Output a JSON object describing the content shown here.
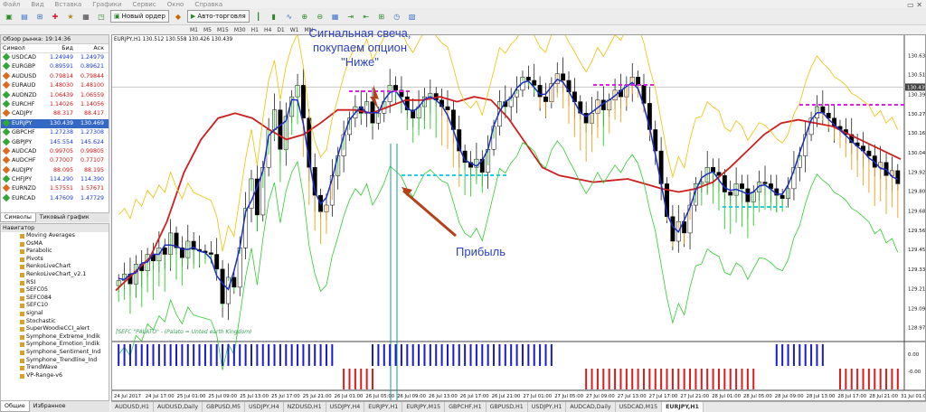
{
  "menu": [
    "Файл",
    "Вид",
    "Вставка",
    "Графики",
    "Сервис",
    "Окно",
    "Справка"
  ],
  "toolbar": {
    "new_order": "Новый ордер",
    "auto_trading": "Авто-торговля",
    "timeframes": [
      "M1",
      "M5",
      "M15",
      "M30",
      "H1",
      "H4",
      "D1",
      "W1",
      "MN"
    ]
  },
  "market_watch": {
    "title": "Обзор рынка: 19:14:36",
    "headers": [
      "Символ",
      "Бид",
      "Аск"
    ],
    "rows": [
      {
        "sym": "USDCAD",
        "bid": "1.24949",
        "ask": "1.24979",
        "color": "#2fa836",
        "dir": "up"
      },
      {
        "sym": "EURGBP",
        "bid": "0.89591",
        "ask": "0.89621",
        "color": "#2fa836",
        "dir": "up"
      },
      {
        "sym": "AUDUSD",
        "bid": "0.79814",
        "ask": "0.79844",
        "color": "#e06a1c",
        "dir": "dn"
      },
      {
        "sym": "EURAUD",
        "bid": "1.48030",
        "ask": "1.48100",
        "color": "#e06a1c",
        "dir": "dn"
      },
      {
        "sym": "AUDNZD",
        "bid": "1.06439",
        "ask": "1.06559",
        "color": "#2fa836",
        "dir": "dn"
      },
      {
        "sym": "EURCHF",
        "bid": "1.14026",
        "ask": "1.14056",
        "color": "#2fa836",
        "dir": "dn"
      },
      {
        "sym": "CADJPY",
        "bid": "88.317",
        "ask": "88.417",
        "color": "#e06a1c",
        "dir": "dn"
      },
      {
        "sym": "EURJPY",
        "bid": "130.439",
        "ask": "130.469",
        "color": "#2fa836",
        "dir": "up",
        "selected": true
      },
      {
        "sym": "GBPCHF",
        "bid": "1.27238",
        "ask": "1.27308",
        "color": "#2fa836",
        "dir": "up"
      },
      {
        "sym": "GBPJPY",
        "bid": "145.554",
        "ask": "145.624",
        "color": "#2fa836",
        "dir": "up"
      },
      {
        "sym": "AUDCAD",
        "bid": "0.99705",
        "ask": "0.99805",
        "color": "#e06a1c",
        "dir": "dn"
      },
      {
        "sym": "AUDCHF",
        "bid": "0.77007",
        "ask": "0.77107",
        "color": "#e06a1c",
        "dir": "dn"
      },
      {
        "sym": "AUDJPY",
        "bid": "88.095",
        "ask": "88.195",
        "color": "#e06a1c",
        "dir": "dn"
      },
      {
        "sym": "CHFJPY",
        "bid": "114.290",
        "ask": "114.390",
        "color": "#2fa836",
        "dir": "up"
      },
      {
        "sym": "EURNZD",
        "bid": "1.57551",
        "ask": "1.57671",
        "color": "#e06a1c",
        "dir": "dn"
      },
      {
        "sym": "EURCAD",
        "bid": "1.47609",
        "ask": "1.47729",
        "color": "#2fa836",
        "dir": "up"
      }
    ],
    "tabs": [
      "Символы",
      "Тиковый график"
    ]
  },
  "navigator": {
    "title": "Навигатор",
    "items": [
      "Moving Averages",
      "OsMA",
      "Parabolic",
      "Pivots",
      "RenkoLiveChart",
      "RenkoLiveChart_v2.1",
      "RSI",
      "SEFC05",
      "SEFC084",
      "SEFC10",
      "signal",
      "Stochastic",
      "SuperWoodieCCI_alert",
      "Symphone_Extreme_Indik",
      "Symphone_Emotion_Indik",
      "Symphone_Sentiment_Ind",
      "Symphone_Trendline_Ind",
      "TrendWave",
      "VP-Range-v6"
    ],
    "tabs": [
      "Общие",
      "Избранное"
    ]
  },
  "chart": {
    "header": "EURJPY,H1  130.512 130.558 130.426 130.439",
    "source_text": "[SEFC \"PALATO\" - (Palato = Unted earth Kingdom)",
    "price_labels": [
      "130.630",
      "130.515",
      "130.395",
      "130.275",
      "130.160",
      "130.040",
      "129.920",
      "129.805",
      "129.685",
      "129.565",
      "129.450",
      "129.330",
      "129.210",
      "129.090",
      "128.975"
    ],
    "current_price": "130.439",
    "osc_labels": [
      "0.00",
      "-0.00"
    ],
    "time_labels": [
      "24 Jul 2017",
      "24 Jul 17:00",
      "25 Jul 01:00",
      "25 Jul 09:00",
      "25 Jul 13:00",
      "25 Jul 17:00",
      "25 Jul 21:00",
      "26 Jul 01:00",
      "26 Jul 05:00",
      "26 Jul 09:00",
      "26 Jul 13:00",
      "26 Jul 17:00",
      "26 Jul 21:00",
      "27 Jul 01:00",
      "27 Jul 05:00",
      "27 Jul 09:00",
      "27 Jul 13:00",
      "27 Jul 17:00",
      "27 Jul 21:00",
      "28 Jul 01:00",
      "28 Jul 05:00",
      "28 Jul 09:00",
      "28 Jul 13:00",
      "28 Jul 17:00",
      "28 Jul 21:00",
      "31 Jul 01:00"
    ],
    "annotation_signal": [
      "Сигнальная свеча,",
      "покупаем опцион",
      "\"Ниже\""
    ],
    "annotation_profit": "Прибыль",
    "tabs": [
      "AUDUSD,H1",
      "AUDUSD,Daily",
      "GBPUSD,M5",
      "USDJPY,H4",
      "NZDUSD,H1",
      "USDJPY,H4",
      "EURJPY,H1",
      "EURJPY,M15",
      "GBPCHF,H1",
      "GBPUSD,H1",
      "USDJPY,H1",
      "AUDCAD,Daily",
      "USDCAD,M15",
      "EURJPY,H1"
    ],
    "active_tab": 13
  },
  "chart_data": {
    "type": "candlestick",
    "y_range": [
      128.9,
      130.7
    ],
    "closes": [
      129.26,
      129.3,
      129.24,
      129.36,
      129.32,
      129.42,
      129.38,
      129.46,
      129.42,
      129.55,
      129.46,
      129.4,
      129.5,
      129.45,
      129.44,
      129.43,
      129.42,
      129.33,
      129.12,
      129.28,
      129.22,
      129.46,
      129.7,
      129.88,
      129.66,
      129.95,
      130.18,
      130.3,
      130.06,
      130.26,
      130.38,
      130.45,
      130.25,
      129.95,
      129.78,
      129.68,
      129.72,
      129.9,
      130.02,
      130.15,
      130.25,
      130.32,
      130.28,
      130.35,
      130.22,
      130.28,
      130.35,
      130.45,
      130.42,
      130.38,
      130.3,
      130.25,
      130.32,
      130.38,
      130.4,
      130.36,
      130.32,
      130.3,
      130.18,
      130.05,
      129.98,
      129.95,
      130.0,
      129.92,
      130.06,
      130.2,
      130.35,
      130.32,
      130.38,
      130.42,
      130.5,
      130.48,
      130.45,
      130.38,
      130.35,
      130.46,
      130.52,
      130.48,
      130.41,
      130.35,
      130.28,
      130.22,
      130.28,
      130.36,
      130.3,
      130.36,
      130.42,
      130.38,
      130.45,
      130.5,
      130.45,
      130.34,
      130.18,
      130.05,
      129.85,
      129.65,
      129.5,
      129.62,
      129.55,
      129.72,
      129.85,
      129.86,
      129.95,
      129.92,
      129.9,
      129.8,
      129.78,
      129.85,
      129.82,
      129.74,
      129.8,
      129.86,
      129.85,
      129.82,
      129.78,
      129.76,
      129.82,
      129.95,
      130.02,
      130.15,
      130.25,
      130.32,
      130.28,
      130.25,
      130.2,
      130.18,
      130.15,
      130.1,
      130.08,
      130.05,
      130.02,
      129.95,
      129.98,
      129.9,
      129.93,
      129.85
    ],
    "sma_red": [
      129.2,
      129.3,
      129.4,
      129.62,
      129.92,
      130.12,
      130.25,
      130.28,
      130.25,
      130.18,
      130.12,
      130.15,
      130.22,
      130.3,
      130.3,
      130.28,
      130.32,
      130.36,
      130.36,
      130.38,
      130.35,
      130.38,
      130.36,
      130.25,
      130.1,
      129.95,
      129.9,
      129.88,
      129.86,
      129.87,
      129.88,
      129.85,
      129.82,
      129.8,
      129.82,
      129.86,
      129.95,
      130.05,
      130.15,
      130.22,
      130.24,
      130.22,
      130.2,
      130.15,
      130.1,
      130.05,
      130.0
    ]
  }
}
